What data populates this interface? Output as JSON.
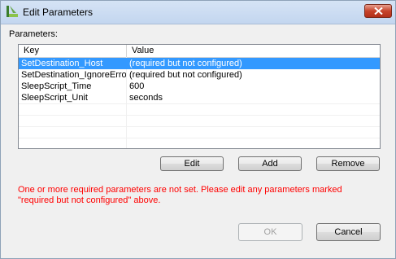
{
  "window": {
    "title": "Edit Parameters",
    "icon": "app-logo-icon"
  },
  "parameters_label": "Parameters:",
  "table": {
    "columns": [
      "Key",
      "Value"
    ],
    "rows": [
      {
        "key": "SetDestination_Host",
        "value": "(required but not configured)",
        "selected": true
      },
      {
        "key": "SetDestination_IgnoreError",
        "value": "(required but not configured)",
        "selected": false
      },
      {
        "key": "SleepScript_Time",
        "value": "600",
        "selected": false
      },
      {
        "key": "SleepScript_Unit",
        "value": "seconds",
        "selected": false
      }
    ]
  },
  "buttons": {
    "edit": "Edit",
    "add": "Add",
    "remove": "Remove",
    "ok": "OK",
    "cancel": "Cancel"
  },
  "error_message": "One or more required parameters are not set. Please edit any parameters marked \"required but not configured\" above.",
  "colors": {
    "selection": "#3399ff",
    "error": "#ff0000"
  }
}
